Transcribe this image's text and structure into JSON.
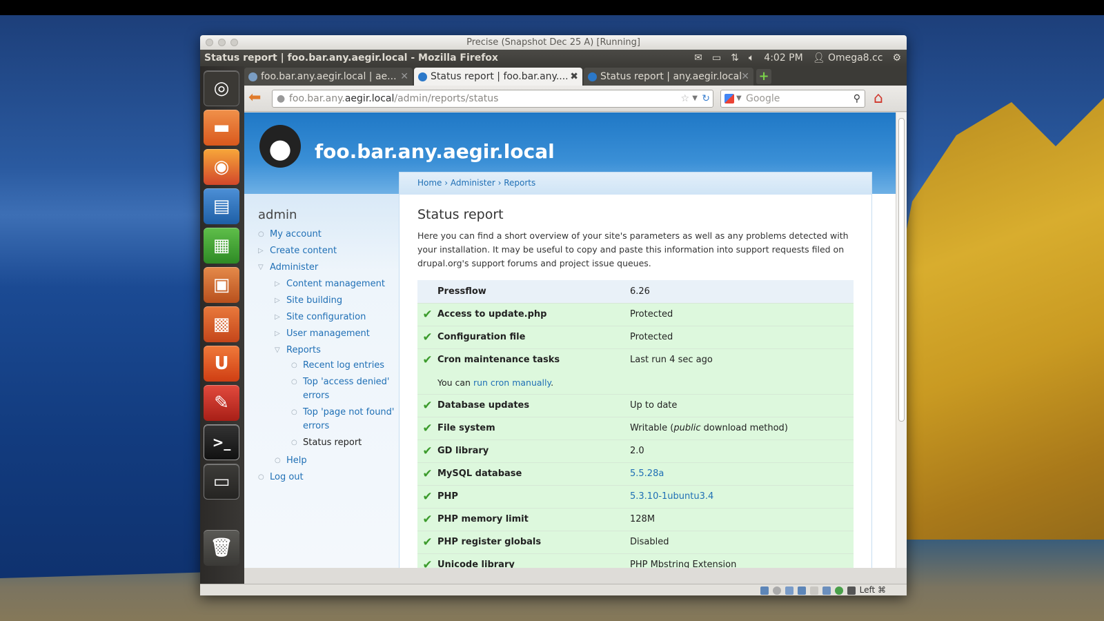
{
  "vm": {
    "title": "Precise (Snapshot Dec 25 A) [Running]",
    "status_host_key": "Left ⌘"
  },
  "panel": {
    "window_title": "Status report | foo.bar.any.aegir.local - Mozilla Firefox",
    "time": "4:02 PM",
    "user": "Omega8.cc"
  },
  "launcher": {
    "items": [
      "dash-home-icon",
      "files-folder-icon",
      "firefox-icon",
      "libreoffice-writer-icon",
      "libreoffice-calc-icon",
      "libreoffice-impress-icon",
      "software-center-icon",
      "ubuntu-one-icon",
      "system-settings-icon",
      "terminal-icon",
      "workspace-switcher-icon",
      "trash-icon"
    ]
  },
  "browser": {
    "tabs": [
      {
        "label": "foo.bar.any.aegir.local | ae..."
      },
      {
        "label": "Status report | foo.bar.any...."
      },
      {
        "label": "Status report | any.aegir.local"
      }
    ],
    "url_prefix": "foo.bar.any.",
    "url_host": "aegir.local",
    "url_path": "/admin/reports/status",
    "search_placeholder": "Google"
  },
  "site": {
    "name": "foo.bar.any.aegir.local"
  },
  "breadcrumb": {
    "home": "Home",
    "administer": "Administer",
    "reports": "Reports",
    "sep": "›"
  },
  "sidebar": {
    "heading": "admin",
    "my_account": "My account",
    "create_content": "Create content",
    "administer": "Administer",
    "content_management": "Content management",
    "site_building": "Site building",
    "site_configuration": "Site configuration",
    "user_management": "User management",
    "reports": "Reports",
    "recent_log": "Recent log entries",
    "top_access_denied": "Top 'access denied' errors",
    "top_page_not_found": "Top 'page not found' errors",
    "status_report": "Status report",
    "help": "Help",
    "log_out": "Log out"
  },
  "main": {
    "title": "Status report",
    "intro": "Here you can find a short overview of your site's parameters as well as any problems detected with your installation. It may be useful to copy and paste this information into support requests filed on drupal.org's support forums and project issue queues.",
    "rows": {
      "pressflow": {
        "name": "Pressflow",
        "value": "6.26"
      },
      "update": {
        "name": "Access to update.php",
        "value": "Protected"
      },
      "config": {
        "name": "Configuration file",
        "value": "Protected"
      },
      "cron": {
        "name": "Cron maintenance tasks",
        "value": "Last run 4 sec ago",
        "desc_prefix": "You can ",
        "desc_link": "run cron manually",
        "desc_suffix": "."
      },
      "dbupdates": {
        "name": "Database updates",
        "value": "Up to date"
      },
      "filesystem": {
        "name": "File system",
        "value_prefix": "Writable (",
        "value_em": "public",
        "value_suffix": " download method)"
      },
      "gd": {
        "name": "GD library",
        "value": "2.0"
      },
      "mysql": {
        "name": "MySQL database",
        "value": "5.5.28a"
      },
      "php": {
        "name": "PHP",
        "value": "5.3.10-1ubuntu3.4"
      },
      "memory": {
        "name": "PHP memory limit",
        "value": "128M"
      },
      "globals": {
        "name": "PHP register globals",
        "value": "Disabled"
      },
      "unicode": {
        "name": "Unicode library",
        "value": "PHP Mbstring Extension"
      }
    }
  },
  "colors": {
    "link": "#1f6fb5",
    "ok_row": "#ddf8dd",
    "check": "#3c9b2c",
    "header_blue": "#1f78c6"
  }
}
